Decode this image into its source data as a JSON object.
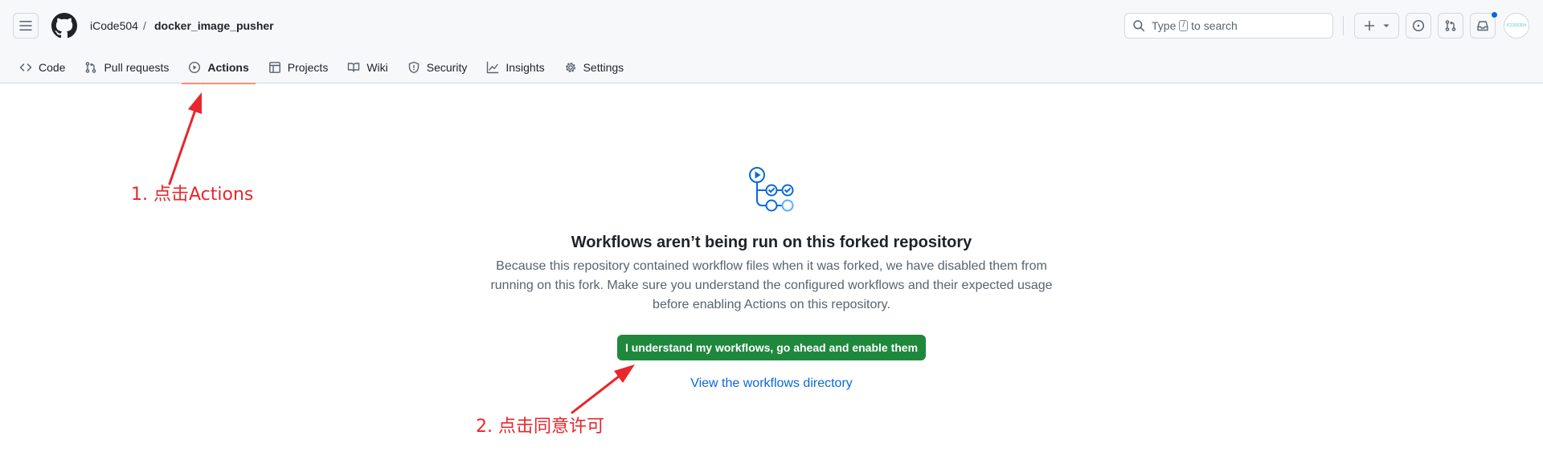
{
  "header": {
    "owner": "iCode504",
    "separator": "/",
    "repo": "docker_image_pusher",
    "search": {
      "prefix": "Type",
      "key": "/",
      "suffix": "to search"
    },
    "avatar_text": "ICODE504"
  },
  "tabs": [
    {
      "label": "Code",
      "icon": "code-icon"
    },
    {
      "label": "Pull requests",
      "icon": "git-pull-request-icon"
    },
    {
      "label": "Actions",
      "icon": "play-icon",
      "selected": true
    },
    {
      "label": "Projects",
      "icon": "table-icon"
    },
    {
      "label": "Wiki",
      "icon": "book-icon"
    },
    {
      "label": "Security",
      "icon": "shield-icon"
    },
    {
      "label": "Insights",
      "icon": "graph-icon"
    },
    {
      "label": "Settings",
      "icon": "gear-icon"
    }
  ],
  "main": {
    "title": "Workflows aren’t being run on this forked repository",
    "description": "Because this repository contained workflow files when it was forked, we have disabled them from running on this fork. Make sure you understand the configured workflows and their expected usage before enabling Actions on this repository.",
    "enable_button": "I understand my workflows, go ahead and enable them",
    "directory_link": "View the workflows directory"
  },
  "annotations": {
    "step1": "1. 点击Actions",
    "step2": "2. 点击同意许可",
    "color": "#e8262b"
  },
  "colors": {
    "accent": "#1f883d",
    "link": "#0969da",
    "tab_underline": "#fd8c73"
  }
}
